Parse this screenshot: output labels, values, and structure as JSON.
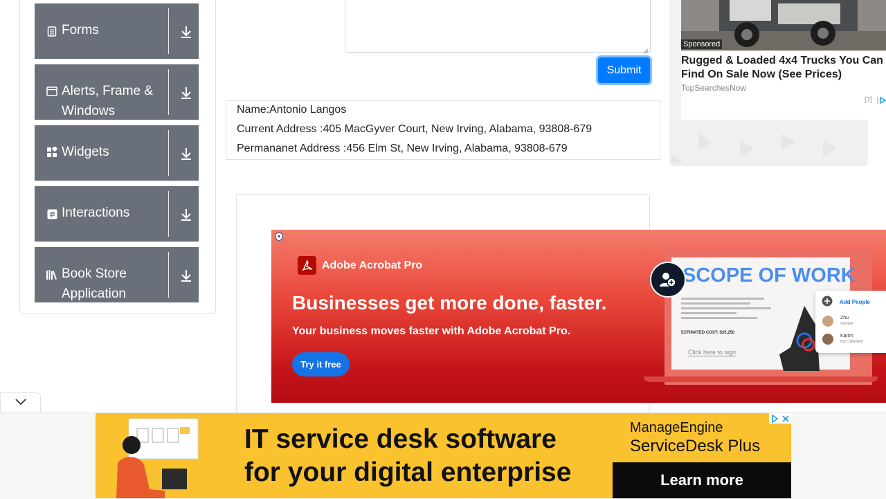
{
  "sidebar": {
    "groups": [
      {
        "title_lines": [
          "Forms"
        ],
        "icon": "form-icon"
      },
      {
        "title_lines": [
          "Alerts, Frame &",
          "Windows"
        ],
        "icon": "window-icon"
      },
      {
        "title_lines": [
          "Widgets"
        ],
        "icon": "widgets-icon"
      },
      {
        "title_lines": [
          "Interactions"
        ],
        "icon": "interactions-icon"
      },
      {
        "title_lines": [
          "Book Store",
          "Application"
        ],
        "icon": "bookstore-icon"
      }
    ]
  },
  "form": {
    "submit_label": "Submit"
  },
  "output": {
    "name": "Name:Antonio Langos",
    "current_address": "Current Address :405 MacGyver Court, New Irving, Alabama, 93808-679",
    "permanent_address": "Permananet Address :456 Elm St, New Irving, Alabama, 93808-679"
  },
  "right_ad": {
    "sponsored": "Sponsored",
    "headline": "Rugged & Loaded 4x4 Trucks You Can Find On Sale Now (See Prices)",
    "source": "TopSearchesNow",
    "adchoice": "[?]"
  },
  "acrobat_ad": {
    "brand": "Adobe Acrobat Pro",
    "headline": "Businesses get more done, faster.",
    "subline": "Your business moves faster with Adobe Acrobat Pro.",
    "cta": "Try it free",
    "doc_title": "SCOPE OF WORK",
    "estimated_cost": "ESTIMATED COST: $35,250",
    "sign_hint": "Click here to sign",
    "people_add": "Add People",
    "person1_name": "Zhu",
    "person1_role": "OWNER",
    "person2_name": "Karim",
    "person2_role": "NOT OPENED"
  },
  "bottom_ad": {
    "line1": "IT service desk software",
    "line2": "for your digital enterprise",
    "brand1": "ManageEngine",
    "brand2": "ServiceDesk Plus",
    "cta": "Learn more"
  },
  "colors": {
    "sidebar_header": "#697079",
    "submit": "#007bff",
    "acrobat_red": "#c5161a",
    "bottom_ad_yellow": "#fac22f"
  }
}
